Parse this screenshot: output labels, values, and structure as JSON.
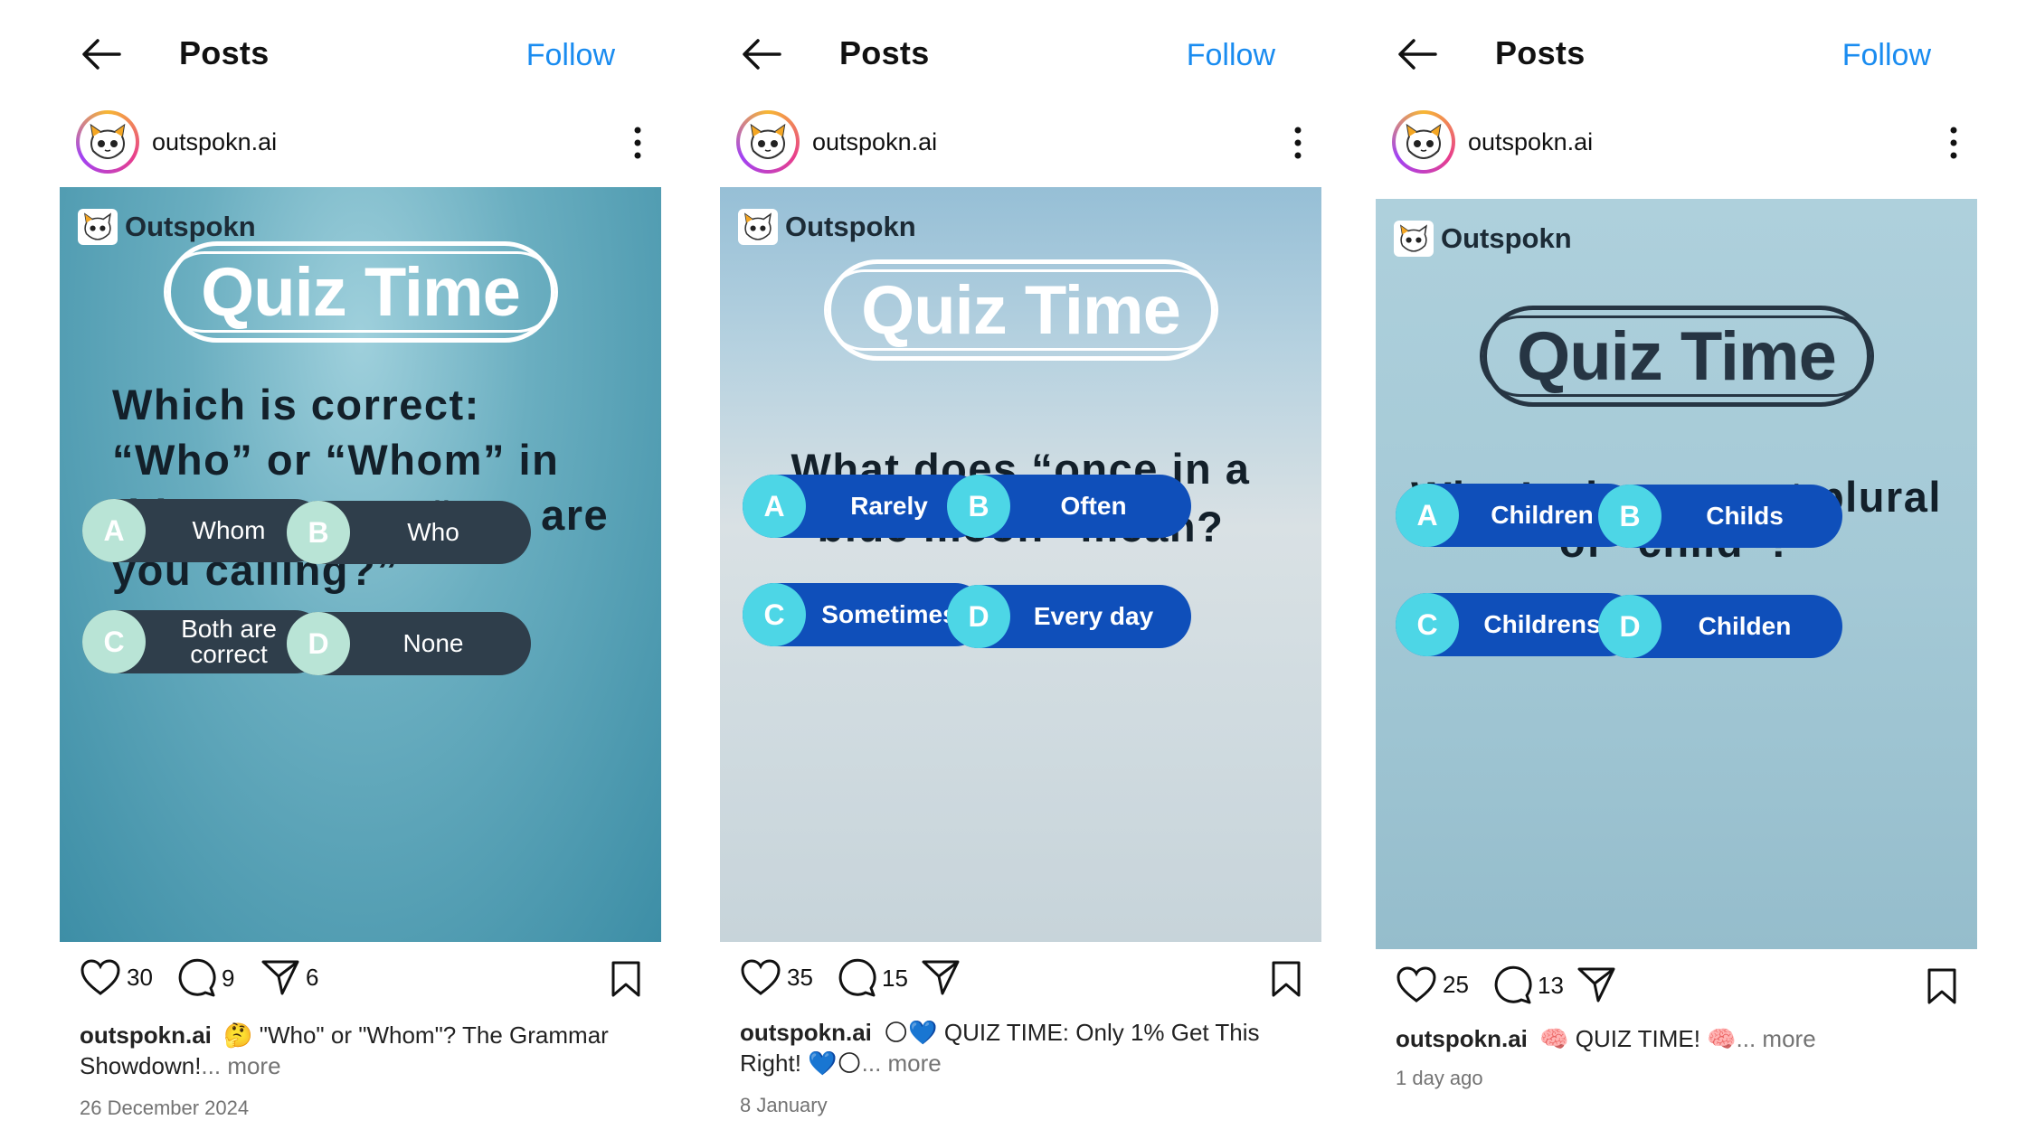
{
  "posts": [
    {
      "header": {
        "title": "Posts",
        "follow": "Follow"
      },
      "username": "outspokn.ai",
      "brand": "Outspokn",
      "quiz_title": "Quiz Time",
      "question": "Which is correct: “Who” or “Whom” in this sentence: “___ are you calling?”",
      "options": [
        {
          "letter": "A",
          "text": "Whom"
        },
        {
          "letter": "B",
          "text": "Who"
        },
        {
          "letter": "C",
          "text": "Both are correct"
        },
        {
          "letter": "D",
          "text": "None"
        }
      ],
      "likes": "30",
      "comments": "9",
      "shares": "6",
      "caption_user": "outspokn.ai",
      "caption_text": "🤔 \"Who\" or \"Whom\"? The Grammar Showdown!",
      "caption_more": "... more",
      "date": "26 December 2024"
    },
    {
      "header": {
        "title": "Posts",
        "follow": "Follow"
      },
      "username": "outspokn.ai",
      "brand": "Outspokn",
      "quiz_title": "Quiz Time",
      "question": "What does “once in a blue moon” mean?",
      "options": [
        {
          "letter": "A",
          "text": "Rarely"
        },
        {
          "letter": "B",
          "text": "Often"
        },
        {
          "letter": "C",
          "text": "Sometimes"
        },
        {
          "letter": "D",
          "text": "Every day"
        }
      ],
      "likes": "35",
      "comments": "15",
      "shares": "",
      "caption_user": "outspokn.ai",
      "caption_text": "🌕💙 QUIZ TIME: Only 1% Get This Right! 💙🌕",
      "caption_more": "... more",
      "date": "8 January"
    },
    {
      "header": {
        "title": "Posts",
        "follow": "Follow"
      },
      "username": "outspokn.ai",
      "brand": "Outspokn",
      "quiz_title": "Quiz Time",
      "question": "What’s the correct plural of “child”?",
      "options": [
        {
          "letter": "A",
          "text": "Children"
        },
        {
          "letter": "B",
          "text": "Childs"
        },
        {
          "letter": "C",
          "text": "Childrens"
        },
        {
          "letter": "D",
          "text": "Childen"
        }
      ],
      "likes": "25",
      "comments": "13",
      "shares": "",
      "caption_user": "outspokn.ai",
      "caption_text": "🧠 QUIZ TIME! 🧠",
      "caption_more": "... more",
      "date": "1 day ago"
    }
  ],
  "icons": [
    "back-arrow-icon",
    "more-options-icon",
    "heart-icon",
    "comment-icon",
    "share-icon",
    "bookmark-icon",
    "cat-logo-icon"
  ],
  "colors": {
    "follow": "#1a8cf0",
    "option_blue": "#0f4fba",
    "option_dark": "#2f3e4b",
    "letter_cyan": "#4dd6e6",
    "letter_mint": "#b9e4d6"
  }
}
